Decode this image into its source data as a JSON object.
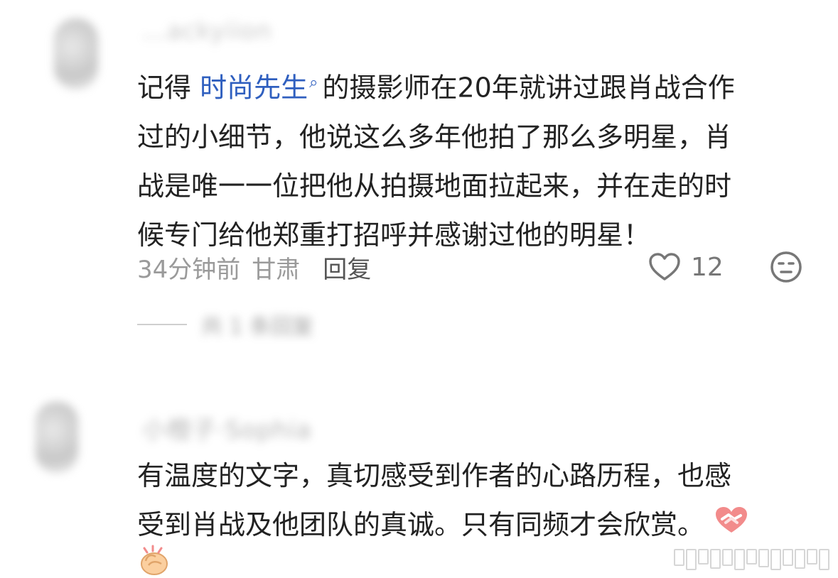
{
  "comments": [
    {
      "username": "…ackyiion",
      "text_before_mention": "记得 ",
      "mention": "时尚先生",
      "lines": [
        "的摄影师在20年就讲过跟肖战合作",
        "过的小细节，他说这么多年他拍了那么多明星，肖",
        "战是唯一一位把他从拍摄地面拉起来，并在走的时",
        "候专门给他郑重打招呼并感谢过他的明星！"
      ],
      "time": "34分钟前",
      "location": "甘肃",
      "reply_label": "回复",
      "like_count": "12",
      "replies_toggle": "共 1 条回复"
    },
    {
      "username": "小橙子·Sophia",
      "lines": [
        "有温度的文字，真切感受到作者的心路历程，也感",
        "受到肖战及他团队的真诚。只有同频才会欣赏。"
      ],
      "inline_emoji": "handshake-heart-emoji",
      "trailing_emoji": "clapping-hands-emoji"
    }
  ],
  "icons": {
    "like": "heart-outline-icon",
    "reaction": "neutral-face-icon",
    "mention_marker": "search-icon",
    "watermark": "barcode-watermark"
  },
  "colors": {
    "mention": "#2f5fbf",
    "meta": "#9a9a9a",
    "text": "#222222"
  }
}
